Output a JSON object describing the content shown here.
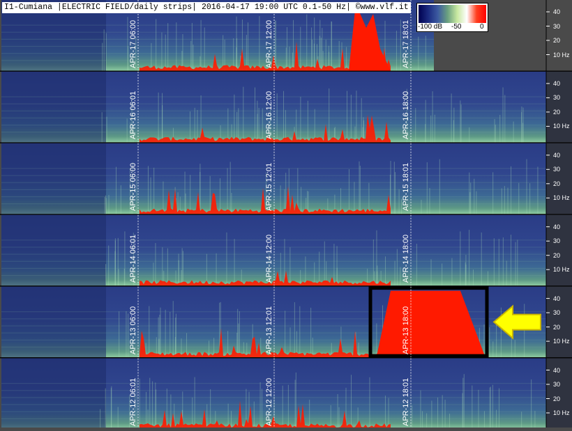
{
  "header": {
    "title": "I1-Cumiana |ELECTRIC FIELD/daily strips| 2016-04-17 19:00 UTC 0.1-50 Hz| ©www.vlf.it"
  },
  "colorbar": {
    "labels": [
      "-100 dB",
      "-50",
      "0"
    ],
    "stops": [
      "#000050",
      "#1a2a80",
      "#3c5aa0",
      "#6aa080",
      "#c8e8a0",
      "#ffffff",
      "#ff4020",
      "#ff0000"
    ]
  },
  "colors": {
    "background_low": "#2c3e8a",
    "band_green": "#6aa67c",
    "hot": "#ff1a00",
    "highlight_box": "#000000",
    "arrow_fill": "#ffff00",
    "arrow_stroke": "#c8b400"
  },
  "chart_data": {
    "type": "heatmap",
    "description_fields": "daily spectrogram strips",
    "frequency_axis_labels": [
      "40",
      "30",
      "20",
      "10 Hz"
    ],
    "frequency_range_hz": [
      0.1,
      50
    ],
    "db_range": [
      -100,
      0
    ],
    "strips": [
      {
        "date_label": "APR-17",
        "time_labels": [
          "06:00",
          "12:00",
          "18:01"
        ],
        "partial": true
      },
      {
        "date_label": "APR-16",
        "time_labels": [
          "06:01",
          "12:00",
          "18:00"
        ]
      },
      {
        "date_label": "APR-15",
        "time_labels": [
          "06:00",
          "12:01",
          "18:01"
        ]
      },
      {
        "date_label": "APR-14",
        "time_labels": [
          "06:01",
          "12:00",
          "18:00"
        ]
      },
      {
        "date_label": "APR-13",
        "time_labels": [
          "06:00",
          "12:01",
          "18:00"
        ],
        "highlighted": true
      },
      {
        "date_label": "APR-12",
        "time_labels": [
          "06:01",
          "12:00",
          "18:01"
        ]
      }
    ]
  }
}
